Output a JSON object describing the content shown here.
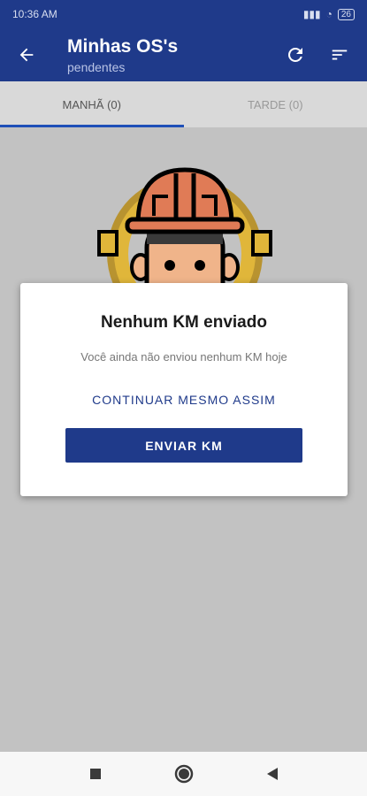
{
  "status_bar": {
    "time": "10:36 AM",
    "extra": "▤",
    "signal": "▮▮▮",
    "wifi": "◔",
    "battery": "26"
  },
  "app_bar": {
    "title": "Minhas OS's",
    "subtitle": "pendentes"
  },
  "tabs": [
    {
      "label": "MANHÃ (0)",
      "active": true
    },
    {
      "label": "TARDE (0)",
      "active": false
    }
  ],
  "dialog": {
    "title": "Nenhum KM enviado",
    "message": "Você ainda não enviou nenhum KM hoje",
    "secondary_action": "CONTINUAR MESMO ASSIM",
    "primary_action": "ENVIAR KM"
  },
  "icons": {
    "back": "arrow-left-icon",
    "refresh": "refresh-icon",
    "filter": "sort-filter-icon",
    "nav_recent": "square-icon",
    "nav_home": "circle-icon",
    "nav_back": "triangle-back-icon"
  },
  "colors": {
    "primary": "#1f3a8a",
    "tab_indicator": "#1f4fb8",
    "overlay": "#c2c2c2"
  }
}
